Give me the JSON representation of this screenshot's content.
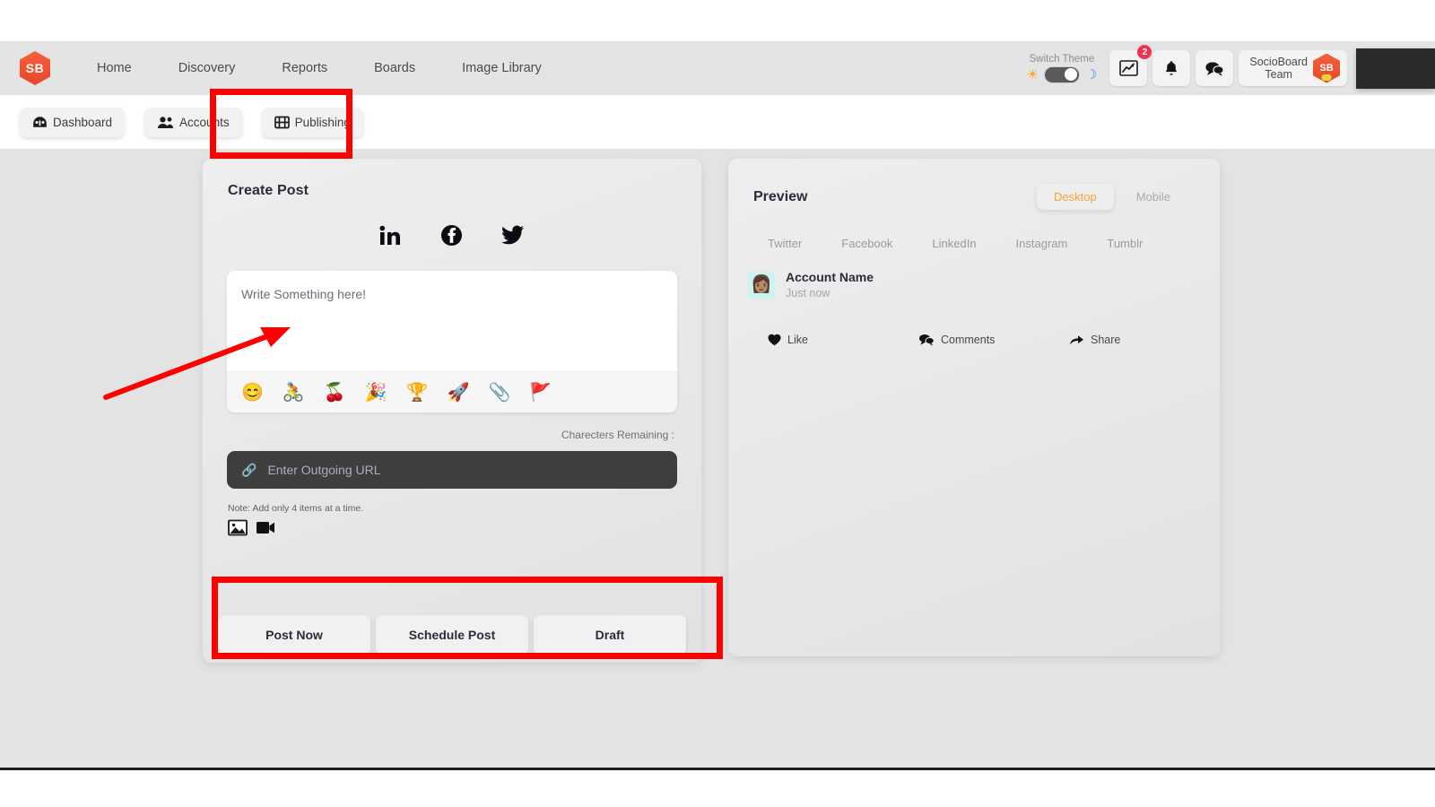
{
  "header": {
    "logo_text": "SB",
    "nav_items": [
      {
        "label": "Home"
      },
      {
        "label": "Discovery"
      },
      {
        "label": "Reports"
      },
      {
        "label": "Boards"
      },
      {
        "label": "Image Library"
      }
    ],
    "theme": {
      "label": "Switch Theme",
      "sun_icon": "sun-icon",
      "moon_icon": "moon-icon",
      "state": "dark"
    },
    "analytics_icon": "analytics-chart-icon",
    "analytics_badge": "2",
    "notification_icon": "bell-icon",
    "messages_icon": "chat-bubble-icon",
    "team_name": "SocioBoard\nTeam",
    "team_logo_text": "SB"
  },
  "subnav": {
    "tabs": [
      {
        "label": "Dashboard",
        "icon": "speedometer-icon"
      },
      {
        "label": "Accounts",
        "icon": "people-icon"
      },
      {
        "label": "Publishing",
        "icon": "film-grid-icon"
      }
    ],
    "active": "Publishing"
  },
  "create_post": {
    "title": "Create Post",
    "networks": [
      {
        "name": "linkedin",
        "icon": "linkedin-icon"
      },
      {
        "name": "facebook",
        "icon": "facebook-icon"
      },
      {
        "name": "twitter",
        "icon": "twitter-icon"
      }
    ],
    "composer_placeholder": "Write Something here!",
    "emoji_bar": [
      {
        "name": "smileys-emoji",
        "glyph": "😊"
      },
      {
        "name": "activities-emoji",
        "glyph": "🚴"
      },
      {
        "name": "food-emoji",
        "glyph": "🍒"
      },
      {
        "name": "celebration-emoji",
        "glyph": "🎉"
      },
      {
        "name": "awards-emoji",
        "glyph": "🏆"
      },
      {
        "name": "travel-emoji",
        "glyph": "🚀"
      },
      {
        "name": "objects-emoji",
        "glyph": "📎"
      },
      {
        "name": "flags-emoji",
        "glyph": "🚩"
      }
    ],
    "characters_remaining_label": "Charecters Remaining :",
    "url_placeholder": "Enter Outgoing URL",
    "url_icon": "link-icon",
    "note": "Note: Add only 4 items at a time.",
    "media_buttons": [
      {
        "name": "add-image-button",
        "icon": "image-icon"
      },
      {
        "name": "add-video-button",
        "icon": "video-camera-icon"
      }
    ],
    "actions": [
      {
        "label": "Post Now"
      },
      {
        "label": "Schedule Post"
      },
      {
        "label": "Draft"
      }
    ]
  },
  "preview": {
    "title": "Preview",
    "view_modes": [
      {
        "label": "Desktop",
        "active": true
      },
      {
        "label": "Mobile",
        "active": false
      }
    ],
    "platform_tabs": [
      {
        "label": "Twitter"
      },
      {
        "label": "Facebook"
      },
      {
        "label": "LinkedIn"
      },
      {
        "label": "Instagram"
      },
      {
        "label": "Tumblr"
      }
    ],
    "account_name": "Account Name",
    "timestamp": "Just now",
    "avatar_glyph": "👩🏽",
    "engagement": [
      {
        "label": "Like",
        "icon": "heart-icon"
      },
      {
        "label": "Comments",
        "icon": "comments-icon"
      },
      {
        "label": "Share",
        "icon": "share-arrow-icon"
      }
    ]
  },
  "annotations": {
    "accent_color": "#fe0000",
    "boxes": [
      {
        "name": "publishing-tab-highlight"
      },
      {
        "name": "action-buttons-highlight"
      }
    ],
    "arrow": {
      "name": "composer-pointer-arrow"
    }
  }
}
